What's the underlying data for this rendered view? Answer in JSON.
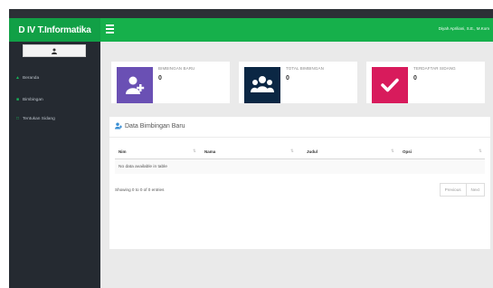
{
  "app": {
    "brand": "D IV T.Informatika"
  },
  "header": {
    "user_name": "Diyah Apriliani, S.E., M.Kom"
  },
  "sidebar": {
    "user_icon": "user-icon",
    "items": [
      {
        "label": "Beranda",
        "icon": "home-icon"
      },
      {
        "label": "Bimbingan",
        "icon": "book-icon"
      },
      {
        "label": "Tentukan Sidang",
        "icon": "calendar-icon"
      }
    ]
  },
  "stats": [
    {
      "label": "BIMBINGAN BARU",
      "value": "0",
      "color": "#6a50b4",
      "icon": "user-plus-icon"
    },
    {
      "label": "TOTAL BIMBINGAN",
      "value": "0",
      "color": "#0b2744",
      "icon": "users-icon"
    },
    {
      "label": "TERDAFTAR SIDANG",
      "value": "0",
      "color": "#d81b5c",
      "icon": "check-icon"
    }
  ],
  "panel": {
    "title": "Data Bimbingan Baru",
    "columns": [
      "Nim",
      "Nama",
      "Judul",
      "Opsi"
    ],
    "empty_text": "No data available in table",
    "info": "Showing 0 to 0 of 0 entries",
    "previous": "Previous",
    "next": "Next"
  },
  "colors": {
    "brand": "#11a046",
    "topbar": "#16b04b",
    "sidebar": "#252a31",
    "content_bg": "#eaeaea"
  }
}
